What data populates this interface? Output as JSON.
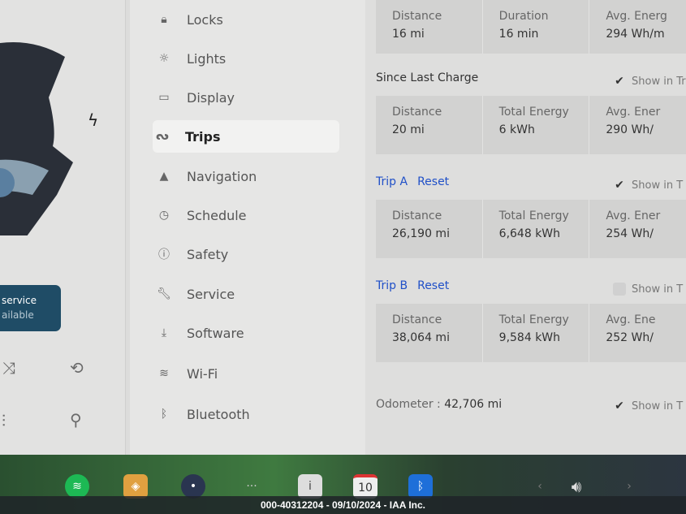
{
  "left": {
    "service_title": "service",
    "service_sub": "ailable"
  },
  "nav": {
    "items": [
      {
        "label": "Locks",
        "icon": "lock-icon",
        "glyph": "🔒︎"
      },
      {
        "label": "Lights",
        "icon": "lights-icon",
        "glyph": "☼"
      },
      {
        "label": "Display",
        "icon": "display-icon",
        "glyph": "▭"
      },
      {
        "label": "Trips",
        "icon": "trips-icon",
        "glyph": "ᔓ"
      },
      {
        "label": "Navigation",
        "icon": "navigation-icon",
        "glyph": "▲"
      },
      {
        "label": "Schedule",
        "icon": "schedule-icon",
        "glyph": "◷"
      },
      {
        "label": "Safety",
        "icon": "safety-icon",
        "glyph": "ⓘ"
      },
      {
        "label": "Service",
        "icon": "wrench-icon",
        "glyph": "🔧︎"
      },
      {
        "label": "Software",
        "icon": "download-icon",
        "glyph": "⤓"
      },
      {
        "label": "Wi-Fi",
        "icon": "wifi-icon",
        "glyph": "≋"
      },
      {
        "label": "Bluetooth",
        "icon": "bluetooth-icon",
        "glyph": "ᛒ"
      }
    ],
    "active": "Trips"
  },
  "main": {
    "recent": {
      "cells": [
        {
          "label": "Distance",
          "value": "16 mi"
        },
        {
          "label": "Duration",
          "value": "16 min"
        },
        {
          "label": "Avg. Energ",
          "value": "294 Wh/m"
        }
      ]
    },
    "since_charge": {
      "title": "Since Last Charge",
      "show": "Show in Tr",
      "checked": true,
      "cells": [
        {
          "label": "Distance",
          "value": "20 mi"
        },
        {
          "label": "Total Energy",
          "value": "6 kWh"
        },
        {
          "label": "Avg. Ener",
          "value": "290 Wh/"
        }
      ]
    },
    "trip_a": {
      "title": "Trip A",
      "reset": "Reset",
      "show": "Show in T",
      "checked": true,
      "cells": [
        {
          "label": "Distance",
          "value": "26,190 mi"
        },
        {
          "label": "Total Energy",
          "value": "6,648 kWh"
        },
        {
          "label": "Avg. Ener",
          "value": "254 Wh/"
        }
      ]
    },
    "trip_b": {
      "title": "Trip B",
      "reset": "Reset",
      "show": "Show in T",
      "checked": false,
      "cells": [
        {
          "label": "Distance",
          "value": "38,064 mi"
        },
        {
          "label": "Total Energy",
          "value": "9,584 kWh"
        },
        {
          "label": "Avg. Ene",
          "value": "252 Wh/"
        }
      ]
    },
    "odometer": {
      "label": "Odometer :",
      "value": "42,706 mi",
      "show": "Show in T",
      "checked": true
    }
  },
  "dock": {
    "calendar_day": "10"
  },
  "watermark": "000-40312204 - 09/10/2024 - IAA Inc.",
  "colors": {
    "link": "#2050c8",
    "service_banner": "#1f4c66",
    "spotify": "#1db954",
    "bluetooth": "#1e6fd9"
  }
}
